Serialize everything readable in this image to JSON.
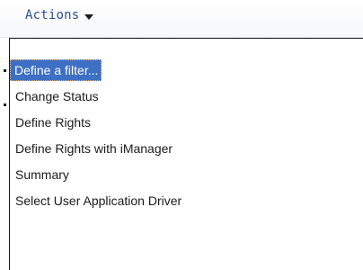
{
  "actions_menu": {
    "trigger_label": "Actions",
    "trigger_icon": "chevron-down-icon",
    "items": [
      {
        "label": "Define a filter...",
        "selected": true
      },
      {
        "label": "Change Status"
      },
      {
        "label": "Define Rights"
      },
      {
        "label": "Define Rights with iManager"
      },
      {
        "label": "Summary"
      },
      {
        "label": "Select User Application Driver"
      }
    ]
  },
  "colors": {
    "trigger_text": "#2a4f8f",
    "selection_background": "#3d6fc4",
    "selection_focus_outline": "#f2b37a",
    "menu_border": "#1a1a1a"
  }
}
